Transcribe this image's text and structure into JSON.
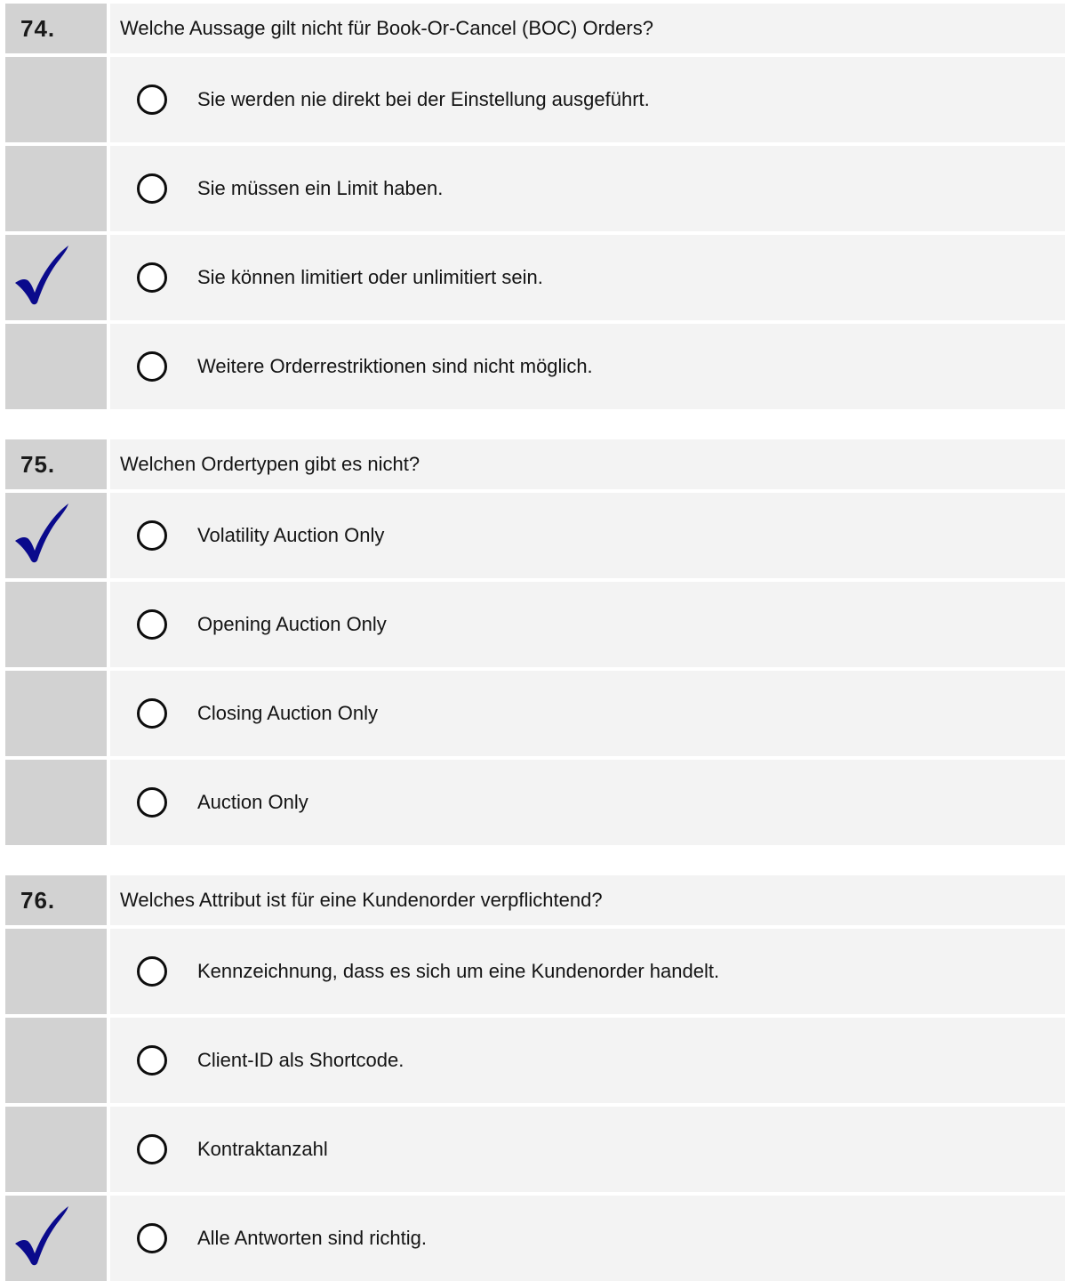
{
  "questions": [
    {
      "number": "74.",
      "text": "Welche Aussage gilt nicht für Book-Or-Cancel (BOC) Orders?",
      "answers": [
        {
          "text": "Sie werden nie direkt bei der Einstellung ausgeführt.",
          "correct": false
        },
        {
          "text": "Sie müssen ein Limit haben.",
          "correct": false
        },
        {
          "text": "Sie können limitiert oder unlimitiert sein.",
          "correct": true
        },
        {
          "text": "Weitere Orderrestriktionen sind nicht möglich.",
          "correct": false
        }
      ]
    },
    {
      "number": "75.",
      "text": "Welchen Ordertypen gibt es nicht?",
      "answers": [
        {
          "text": "Volatility Auction Only",
          "correct": true
        },
        {
          "text": "Opening Auction Only",
          "correct": false
        },
        {
          "text": "Closing Auction Only",
          "correct": false
        },
        {
          "text": "Auction Only",
          "correct": false
        }
      ]
    },
    {
      "number": "76.",
      "text": "Welches Attribut ist für eine Kundenorder verpflichtend?",
      "answers": [
        {
          "text": "Kennzeichnung, dass es sich um eine Kundenorder handelt.",
          "correct": false
        },
        {
          "text": "Client-ID als Shortcode.",
          "correct": false
        },
        {
          "text": "Kontraktanzahl",
          "correct": false
        },
        {
          "text": "Alle Antworten sind richtig.",
          "correct": true
        }
      ]
    }
  ],
  "colors": {
    "checkmark": "#0a0a8c",
    "number_cell": "#d2d2d2",
    "content_cell": "#f3f3f3"
  }
}
